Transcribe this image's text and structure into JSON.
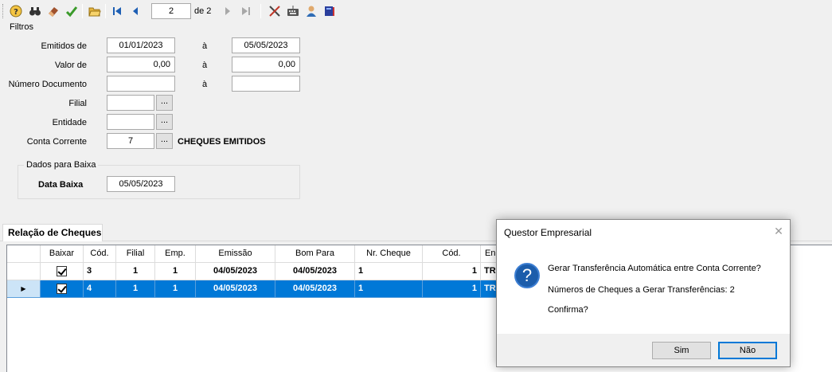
{
  "toolbar": {
    "icons": [
      "help-icon",
      "binoculars-icon",
      "eraser-icon",
      "checkmark-icon",
      "open-folder-icon",
      "first-record-icon",
      "previous-record-icon",
      "next-record-icon",
      "last-record-icon",
      "tools-icon",
      "keyboard-icon",
      "user-icon",
      "book-icon"
    ],
    "page_value": "2",
    "page_of": "de 2"
  },
  "filters": {
    "title": "Filtros",
    "emitidos_label": "Emitidos de",
    "emitidos_from": "01/01/2023",
    "emitidos_to": "05/05/2023",
    "valor_label": "Valor de",
    "valor_from": "0,00",
    "valor_to": "0,00",
    "numero_label": "Número Documento",
    "numero_from": "",
    "numero_to": "",
    "range_sep": "à",
    "filial_label": "Filial",
    "filial_value": "",
    "entidade_label": "Entidade",
    "entidade_value": "",
    "conta_label": "Conta Corrente",
    "conta_value": "7",
    "conta_desc": "CHEQUES EMITIDOS",
    "ellipsis": "..."
  },
  "baixa": {
    "title": "Dados para Baixa",
    "data_label": "Data Baixa",
    "data_value": "05/05/2023"
  },
  "tab": {
    "label": "Relação de Cheques"
  },
  "grid": {
    "columns": [
      "Baixar",
      "Cód.",
      "Filial",
      "Emp.",
      "Emissão",
      "Bom Para",
      "Nr. Cheque",
      "Cód.",
      "En"
    ],
    "rows": [
      {
        "cod": "3",
        "filial": "1",
        "emp": "1",
        "emissao": "04/05/2023",
        "bom_para": "04/05/2023",
        "nr_cheque": "1",
        "cod2": "1",
        "en": "TR"
      },
      {
        "cod": "4",
        "filial": "1",
        "emp": "1",
        "emissao": "04/05/2023",
        "bom_para": "04/05/2023",
        "nr_cheque": "1",
        "cod2": "1",
        "en": "TR"
      }
    ]
  },
  "dialog": {
    "title": "Questor Empresarial",
    "line1": "Gerar Transferência Automática entre Conta Corrente?",
    "line2": "Números de Cheques a Gerar Transferências: 2",
    "line3": "Confirma?",
    "yes_label": "Sim",
    "no_label": "Não",
    "icon_glyph": "?",
    "close_glyph": "✕"
  },
  "colors": {
    "selection": "#0078d7",
    "dialog_icon": "#1c5dab"
  }
}
